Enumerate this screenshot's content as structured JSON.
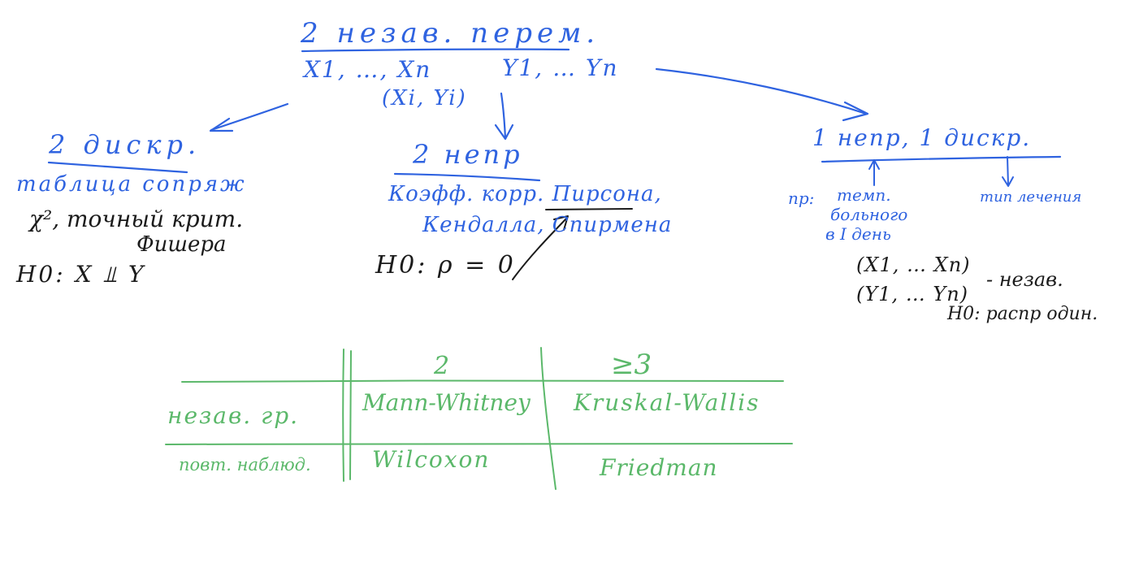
{
  "top": {
    "title": "2 незав. перем.",
    "x_vars": "X1, …, Xn",
    "y_vars": "Y1, … Yn",
    "pairs": "(Xi, Yi)"
  },
  "left": {
    "title": "2 дискр.",
    "subtitle": "таблица сопряж",
    "tests_line1": "χ², точный крит.",
    "tests_line2": "Фишера",
    "hypothesis": "H0:  X ⫫ Y"
  },
  "center": {
    "title": "2 непр",
    "line1": "Коэфф. корр. Пирсона,",
    "line2": "Кендалла, Спирмена",
    "hypothesis": "H0:  ρ = 0"
  },
  "right": {
    "title": "1 непр, 1 дискр.",
    "example_prefix": "пр:",
    "example_line1": "темп.",
    "example_line2": "больного",
    "example_line3": "в I день",
    "treatment": "тип лечения",
    "samples_x": "(X1, … Xn)",
    "samples_y": "(Y1, … Yn)",
    "samples_label": "- незав.",
    "hypothesis": "H0: распр один."
  },
  "table": {
    "col_headers": [
      "2",
      "≥3"
    ],
    "rows": [
      {
        "label": "незав. гр.",
        "cells": [
          "Mann-Whitney",
          "Kruskal-Wallis"
        ]
      },
      {
        "label": "повт. наблюд.",
        "cells": [
          "Wilcoxon",
          "Friedman"
        ]
      }
    ]
  },
  "colors": {
    "blue": "#2f63e0",
    "black": "#1b1b1b",
    "green": "#5bb86a"
  }
}
